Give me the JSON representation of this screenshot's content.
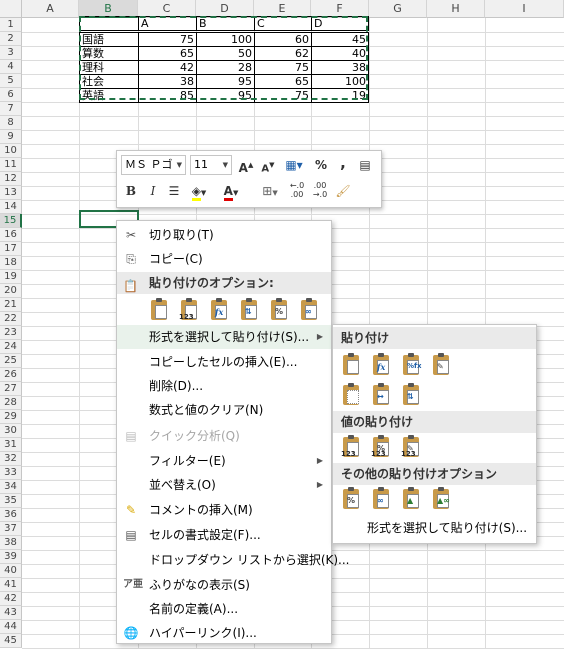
{
  "columns": [
    "A",
    "B",
    "C",
    "D",
    "E",
    "F",
    "G",
    "H",
    "I"
  ],
  "selected_column": "B",
  "rows": [
    "1",
    "2",
    "3",
    "4",
    "5",
    "6",
    "7",
    "8",
    "9",
    "10",
    "11",
    "12",
    "13",
    "14",
    "15",
    "16",
    "17",
    "18",
    "19",
    "20",
    "21",
    "22",
    "23",
    "24",
    "25",
    "26",
    "27",
    "28",
    "29",
    "30",
    "31",
    "32",
    "33",
    "34",
    "35",
    "36",
    "37",
    "38",
    "39",
    "40",
    "41",
    "42",
    "43",
    "44",
    "45"
  ],
  "selected_row": "15",
  "table": {
    "header": [
      "A",
      "B",
      "C",
      "D"
    ],
    "rows": [
      {
        "subject": "国語",
        "values": [
          "75",
          "100",
          "60",
          "45"
        ]
      },
      {
        "subject": "算数",
        "values": [
          "65",
          "50",
          "62",
          "40"
        ]
      },
      {
        "subject": "理科",
        "values": [
          "42",
          "28",
          "75",
          "38"
        ]
      },
      {
        "subject": "社会",
        "values": [
          "38",
          "95",
          "65",
          "100"
        ]
      },
      {
        "subject": "英語",
        "values": [
          "85",
          "95",
          "75",
          "19"
        ]
      }
    ]
  },
  "mini_toolbar": {
    "font_name": "ＭＳ Ｐゴ",
    "font_size": "11",
    "percent": "%",
    "comma": ",",
    "bold": "B",
    "italic": "I",
    "font_color_letter": "A",
    "inc_decimal": "←.0\n.00",
    "dec_decimal": ".00\n→.0"
  },
  "context_menu": {
    "cut": "切り取り(T)",
    "copy": "コピー(C)",
    "paste_options_header": "貼り付けのオプション:",
    "paste_special": "形式を選択して貼り付け(S)...",
    "insert_copied": "コピーしたセルの挿入(E)...",
    "delete": "削除(D)...",
    "clear": "数式と値のクリア(N)",
    "quick_analysis": "クイック分析(Q)",
    "filter": "フィルター(E)",
    "sort": "並べ替え(O)",
    "insert_comment": "コメントの挿入(M)",
    "format_cells": "セルの書式設定(F)...",
    "pick_dropdown": "ドロップダウン リストから選択(K)...",
    "phonetic": "ふりがなの表示(S)",
    "define_name": "名前の定義(A)...",
    "hyperlink": "ハイパーリンク(I)..."
  },
  "submenu": {
    "paste_header": "貼り付け",
    "values_header": "値の貼り付け",
    "other_header": "その他の貼り付けオプション",
    "paste_special": "形式を選択して貼り付け(S)..."
  },
  "paste_badge": "123",
  "colors": {
    "accent": "#217346",
    "highlight": "#e9f2eb",
    "clipboard": "#c89a4a"
  }
}
